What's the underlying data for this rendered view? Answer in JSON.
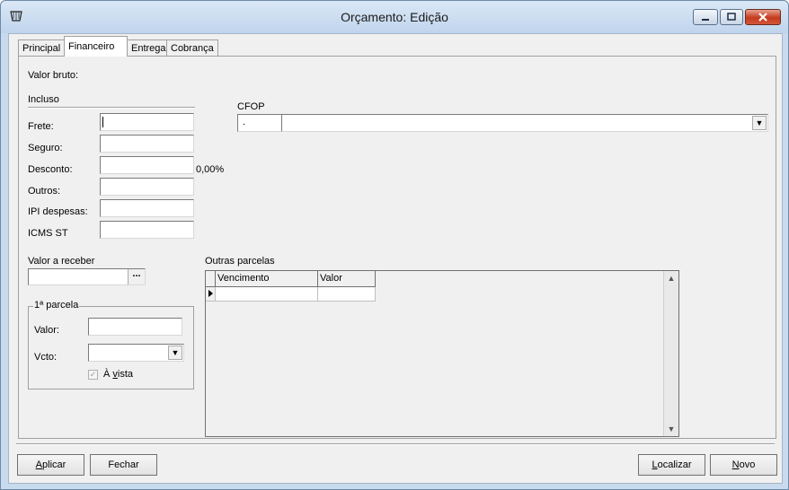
{
  "window": {
    "title": "Orçamento: Edição"
  },
  "tabs": [
    {
      "label": "Principal"
    },
    {
      "label": "Financeiro"
    },
    {
      "label": "Entrega"
    },
    {
      "label": "Cobrança"
    }
  ],
  "financeiro": {
    "valor_bruto_label": "Valor bruto:",
    "incluso_label": "Incluso",
    "fields": {
      "frete": {
        "label": "Frete:",
        "value": ""
      },
      "seguro": {
        "label": "Seguro:",
        "value": ""
      },
      "desconto": {
        "label": "Desconto:",
        "value": "",
        "percent": "0,00%"
      },
      "outros": {
        "label": "Outros:",
        "value": ""
      },
      "ipi_despesas": {
        "label": "IPI despesas:",
        "value": ""
      },
      "icms_st": {
        "label": "ICMS ST",
        "value": ""
      }
    },
    "cfop": {
      "label": "CFOP",
      "code": ".",
      "description": ""
    },
    "valor_receber": {
      "label": "Valor a receber",
      "value": "",
      "ellipsis": "..."
    },
    "primeira_parcela": {
      "group_label": "1ª parcela",
      "valor_label": "Valor:",
      "valor_value": "",
      "vcto_label": "Vcto:",
      "vcto_value": "",
      "a_vista_prefix": "À ",
      "a_vista_hotkey": "v",
      "a_vista_suffix": "ista",
      "a_vista_checked": true
    },
    "outras_parcelas": {
      "label": "Outras parcelas",
      "columns": [
        "Vencimento",
        "Valor"
      ]
    }
  },
  "buttons": {
    "aplicar_hotkey": "A",
    "aplicar_rest": "plicar",
    "fechar": "Fechar",
    "localizar_hotkey": "L",
    "localizar_rest": "ocalizar",
    "novo_hotkey": "N",
    "novo_rest": "ovo"
  }
}
